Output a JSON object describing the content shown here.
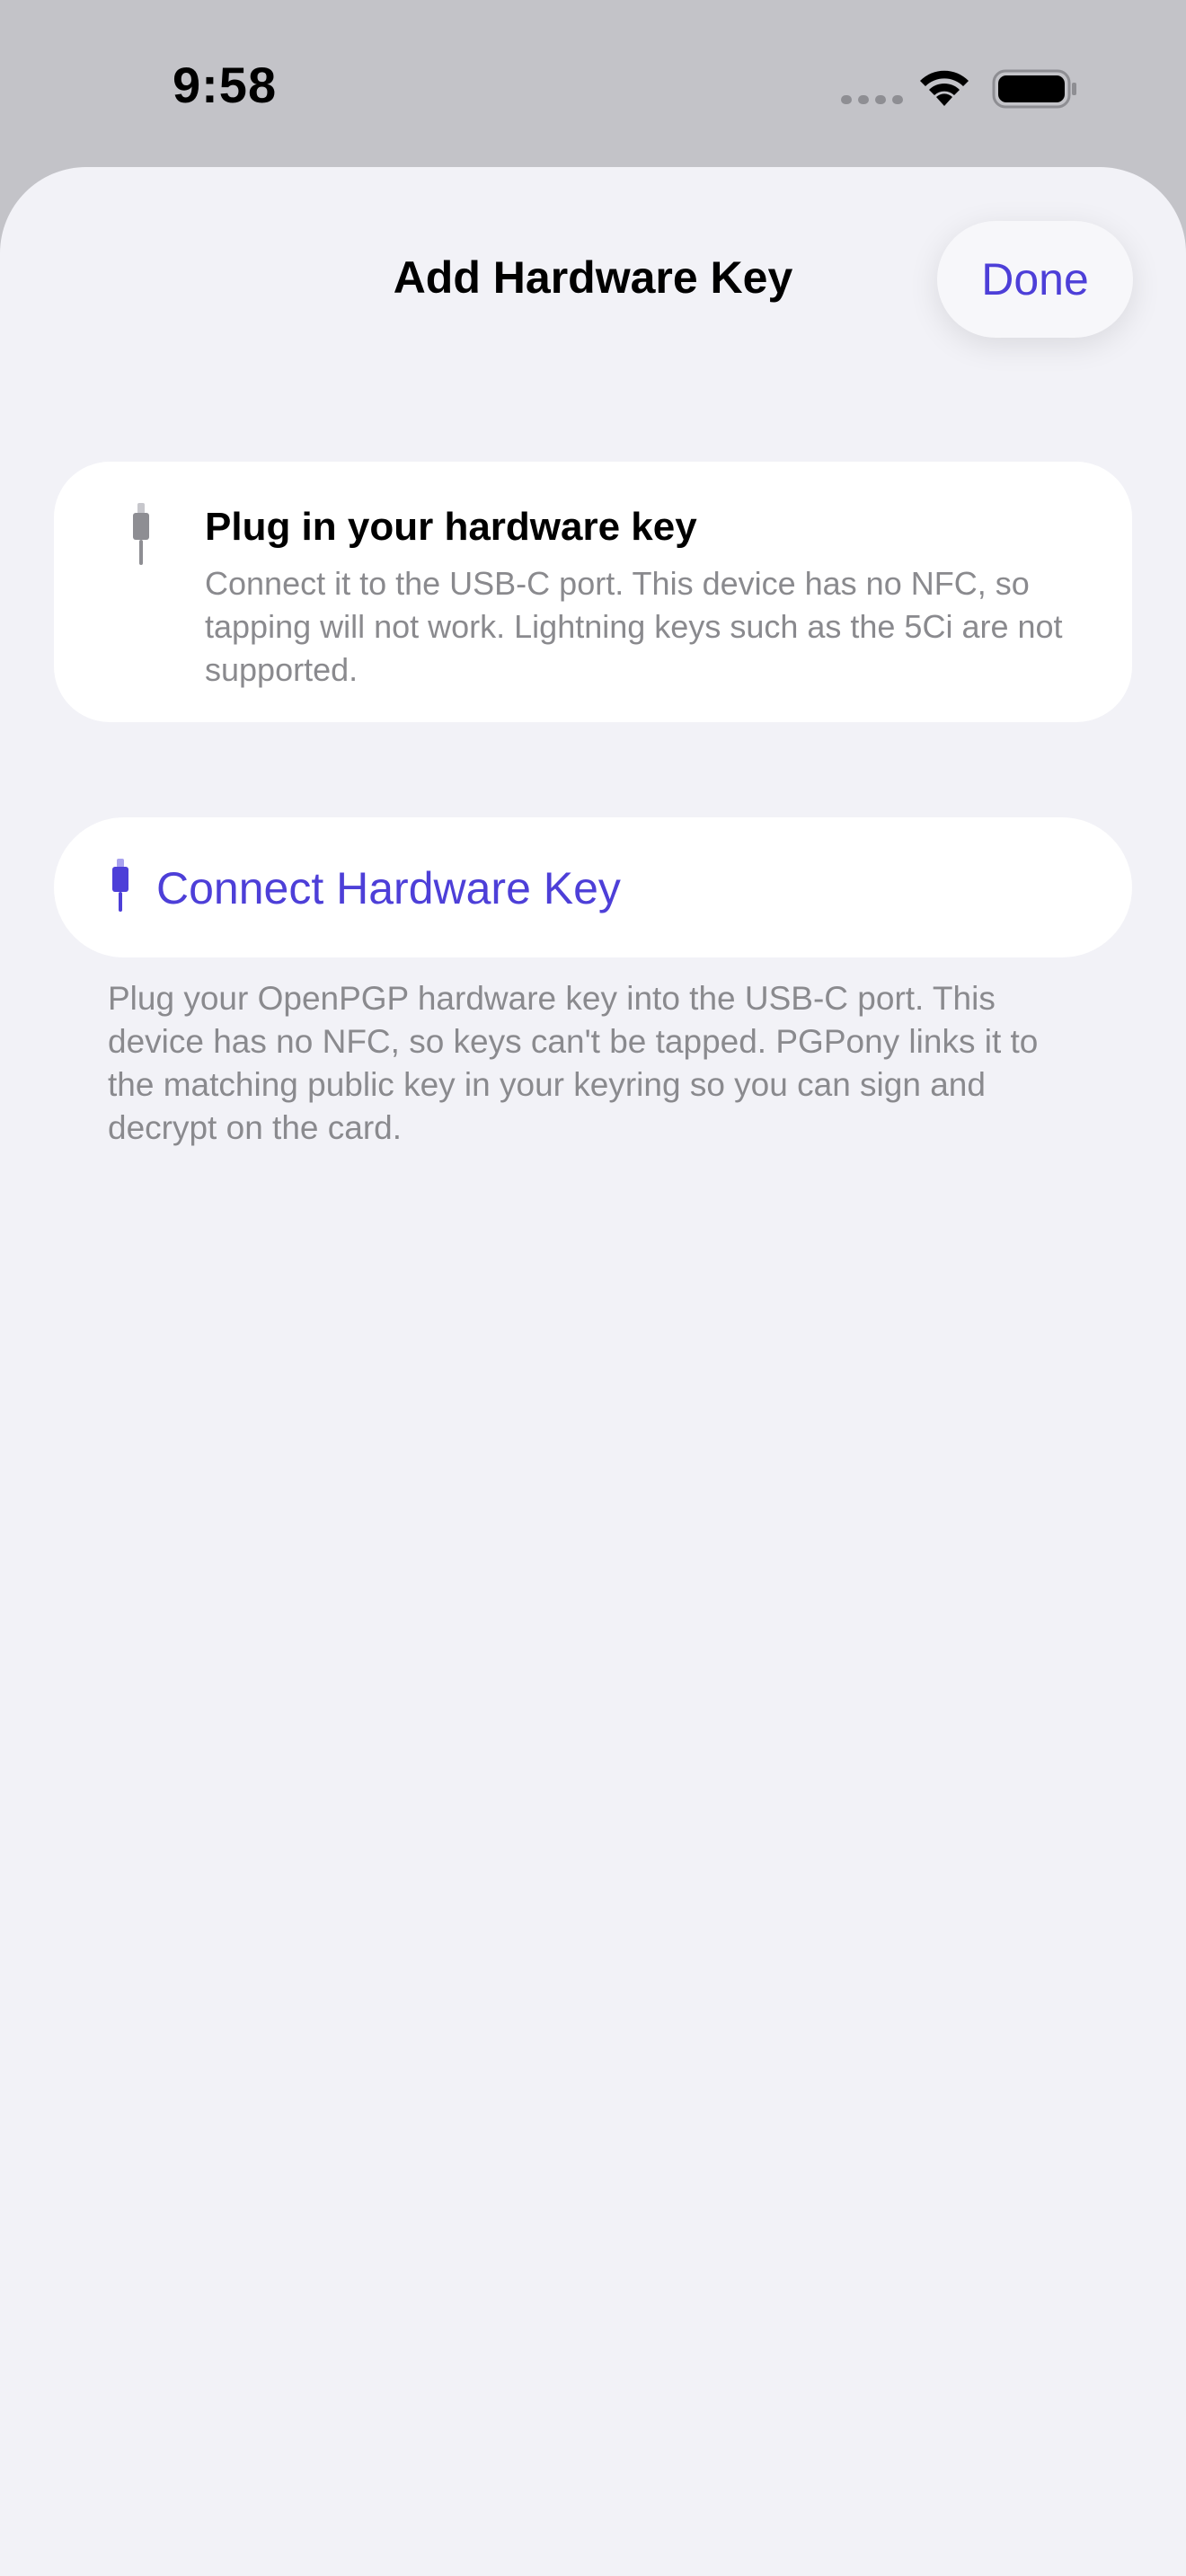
{
  "status_bar": {
    "time": "9:58",
    "icons": [
      "cellular-signal-icon",
      "wifi-icon",
      "battery-icon"
    ]
  },
  "sheet": {
    "title": "Add Hardware Key",
    "done_label": "Done"
  },
  "info_card": {
    "icon": "usb-plug-icon",
    "title": "Plug in your hardware key",
    "body": "Connect it to the USB-C port. This device has no NFC, so tapping will not work. Lightning keys such as the 5Ci are not supported."
  },
  "connect": {
    "icon": "usb-plug-icon",
    "label": "Connect Hardware Key",
    "note": "Plug your OpenPGP hardware key into the USB-C port. This device has no NFC, so keys can't be tapped. PGPony links it to the matching public key in your keyring so you can sign and decrypt on the card."
  },
  "colors": {
    "accent": "#4d3fd8",
    "sheet_background": "#f2f2f7",
    "dimmed_background": "#c3c3c8",
    "secondary_text": "#8a8a8e"
  }
}
